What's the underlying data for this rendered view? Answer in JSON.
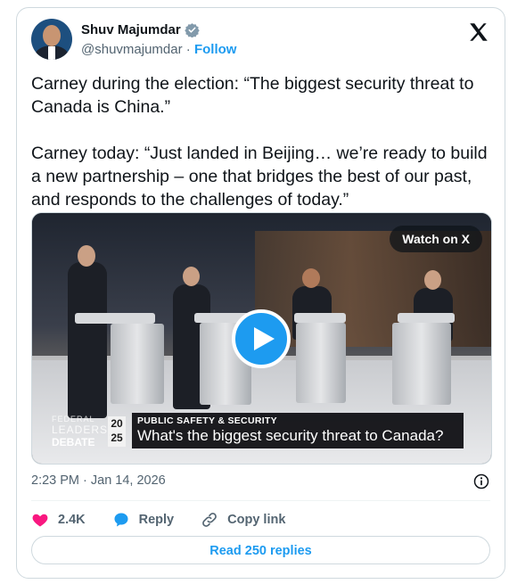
{
  "author": {
    "name": "Shuv Majumdar",
    "handle": "@shuvmajumdar",
    "separator": "·",
    "follow_label": "Follow"
  },
  "tweet": {
    "paragraphs": [
      "Carney during the election: “The biggest security threat to Canada is China.”",
      "Carney today: “Just landed in Beijing… we’re ready to build a new partnership – one that bridges the best of our past, and responds to the challenges of today.”"
    ],
    "timestamp": "2:23 PM · Jan 14, 2026"
  },
  "media": {
    "watch_label": "Watch on X",
    "chyron_tag": "PUBLIC SAFETY & SECURITY",
    "chyron_text": "What's the biggest security threat to Canada?",
    "logo_line1": "FEDERAL",
    "logo_line2": "LEADERS",
    "logo_line3": "DEBATE",
    "logo_year_top": "20",
    "logo_year_bottom": "25"
  },
  "actions": {
    "likes": "2.4K",
    "reply_label": "Reply",
    "copy_label": "Copy link"
  },
  "read_replies_label": "Read 250 replies",
  "colors": {
    "accent": "#1d9bf0",
    "like": "#f91880",
    "muted": "#536471"
  }
}
